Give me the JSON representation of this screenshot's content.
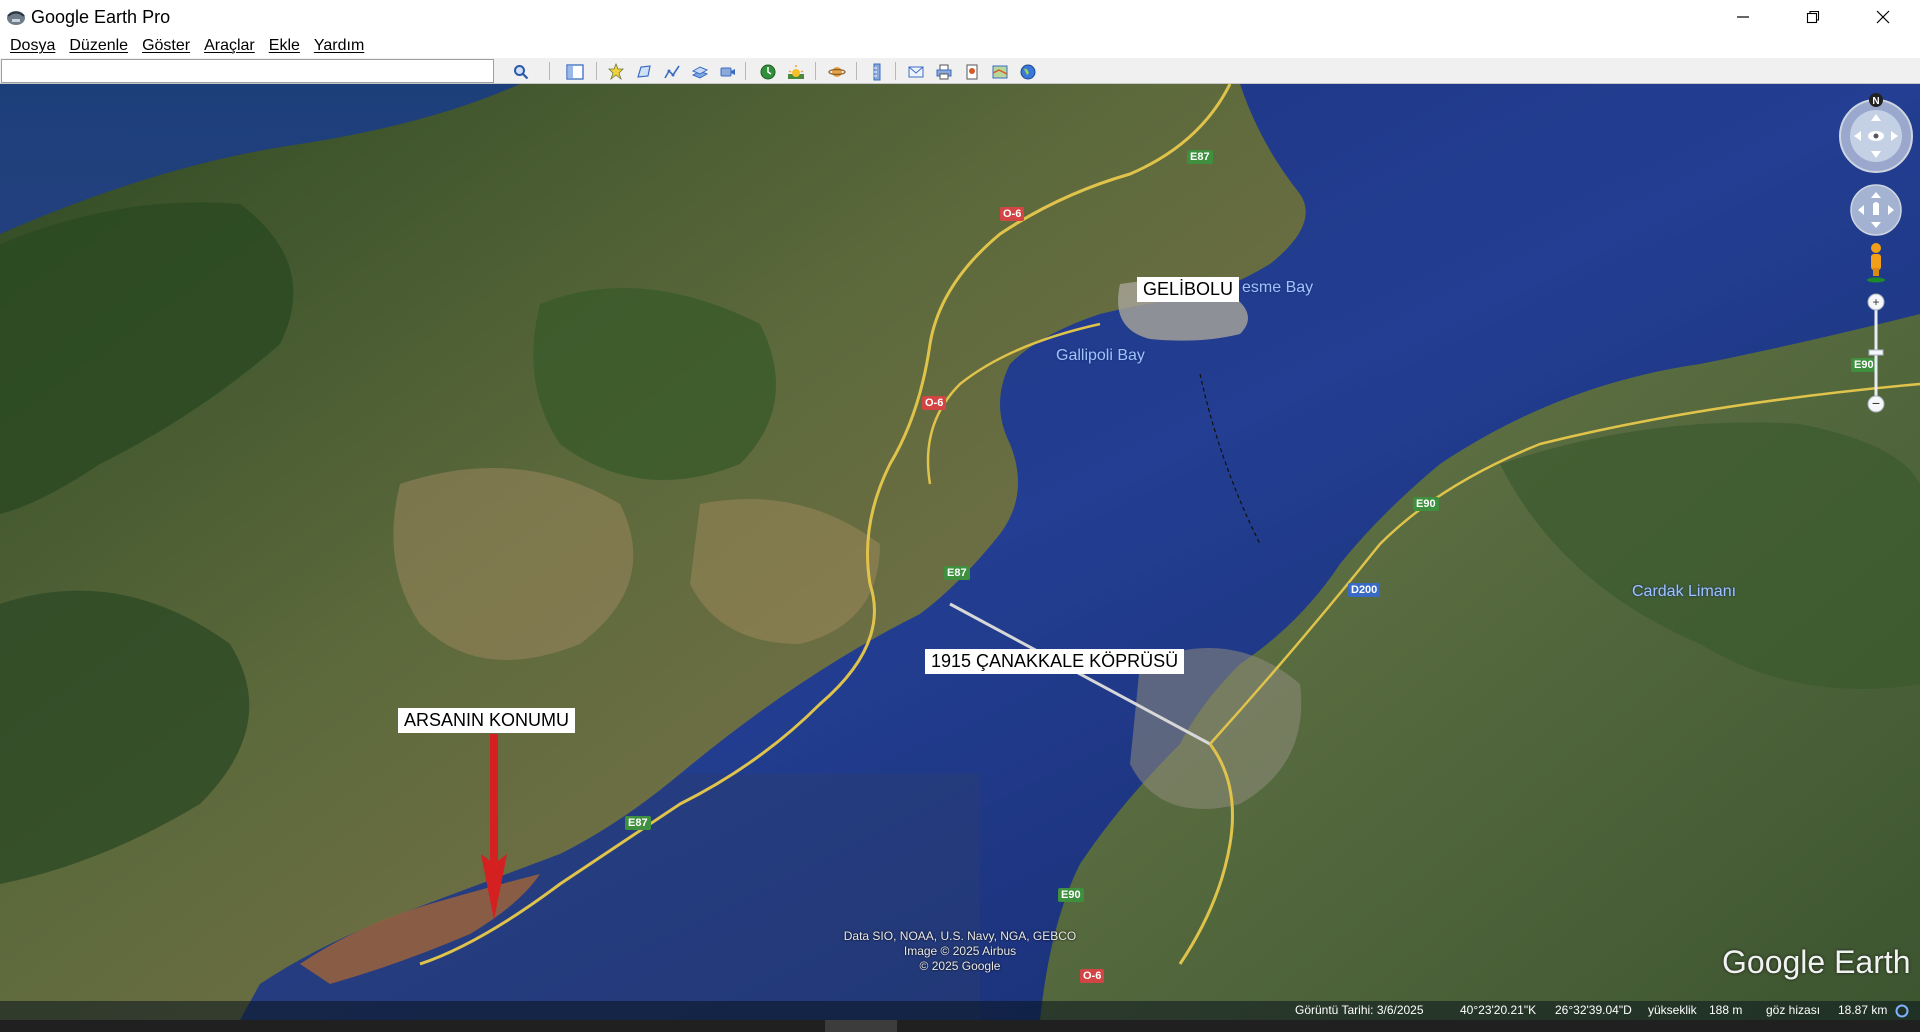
{
  "window": {
    "title": "Google Earth Pro",
    "icons": {
      "app": "google-earth-icon",
      "minimize": "minimize-icon",
      "maximize": "restore-icon",
      "close": "close-icon"
    }
  },
  "menu": {
    "items": [
      "Dosya",
      "Düzenle",
      "Göster",
      "Araçlar",
      "Ekle",
      "Yardım"
    ]
  },
  "toolbar": {
    "search_value": "",
    "buttons": [
      "search-icon",
      "sidebar-icon",
      "placemark-icon",
      "polygon-icon",
      "path-icon",
      "image-overlay-icon",
      "record-tour-icon",
      "historical-imagery-icon",
      "sunlight-icon",
      "planets-icon",
      "ruler-icon",
      "email-icon",
      "print-icon",
      "save-image-icon",
      "view-in-maps-icon",
      "earth-icon"
    ]
  },
  "map": {
    "annotations": {
      "gelibolu": "GELİBOLU",
      "bridge": "1915 ÇANAKKALE KÖPRÜSÜ",
      "plot": "ARSANIN KONUMU"
    },
    "places": {
      "gallipoli_bay": "Gallipoli Bay",
      "cesme_bay": "esme Bay",
      "cardak": "Cardak Limanı"
    },
    "roads": {
      "e87_top": "E87",
      "o6_top": "O-6",
      "o6_mid": "O-6",
      "e87_mid": "E87",
      "e87_low": "E87",
      "e90_right": "E90",
      "e90_mid": "E90",
      "e90_low": "E90",
      "d200": "D200",
      "o6_low": "O-6"
    },
    "attribution": {
      "line1": "Data SIO, NOAA, U.S. Navy, NGA, GEBCO",
      "line2": "Image © 2025 Airbus",
      "line3": "© 2025 Google"
    },
    "logo": "Google Earth"
  },
  "status": {
    "imagery_date": "Görüntü Tarihi: 3/6/2025",
    "latitude": "40°23'20.21\"K",
    "longitude": "26°32'39.04\"D",
    "elevation_label": "yükseklik",
    "elevation_value": "188 m",
    "eye_label": "göz hizası",
    "eye_value": "18.87 km"
  },
  "colors": {
    "sea": "#1e3a8a",
    "land_green": "#3f5a2a",
    "land_brown": "#8a7650",
    "annotation_arrow": "#d42020"
  }
}
